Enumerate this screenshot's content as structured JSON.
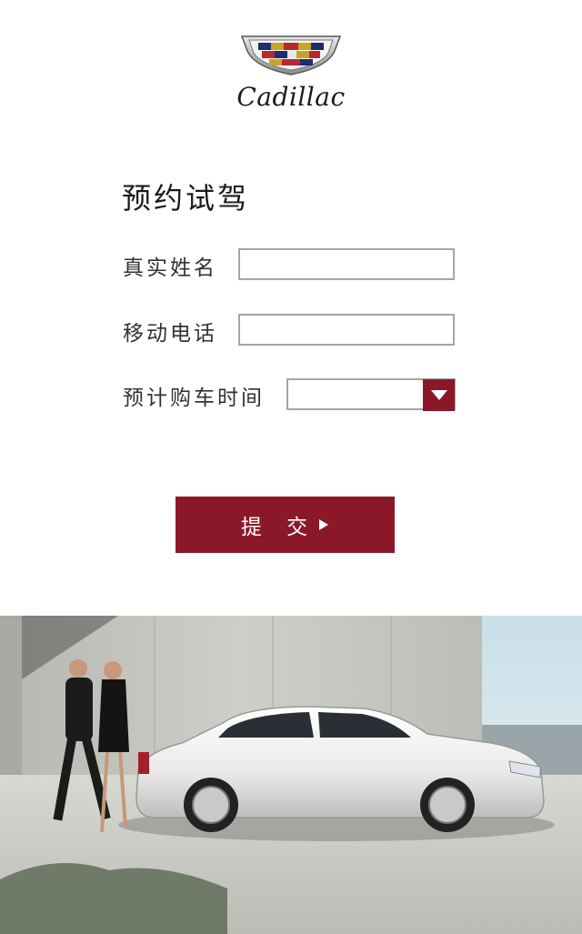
{
  "brand": {
    "logo_icon": "cadillac-crest-icon",
    "wordmark": "Cadillac"
  },
  "form": {
    "title": "预约试驾",
    "name_label": "真实姓名",
    "name_value": "",
    "phone_label": "移动电话",
    "phone_value": "",
    "purchase_time_label": "预计购车时间",
    "purchase_time_selected": "",
    "dropdown_icon": "triangle-down-icon",
    "submit_label": "提 交",
    "submit_icon": "play-arrow-icon"
  },
  "hero": {
    "image_subject": "white sedan with couple walking beside concrete wall"
  },
  "colors": {
    "brand_accent": "#8b1829",
    "input_border": "#a5a5a5",
    "background": "#ffffff"
  }
}
